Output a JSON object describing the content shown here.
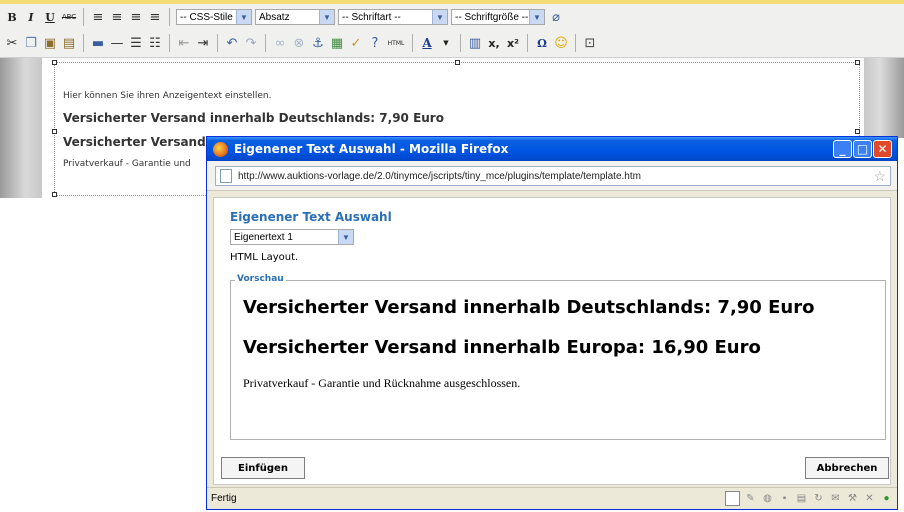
{
  "toolbar": {
    "row1": {
      "bold": "B",
      "italic": "I",
      "underline": "U",
      "strike": "ABC",
      "styles_select": "-- CSS-Stile --",
      "format_select": "Absatz",
      "font_select": "-- Schriftart --",
      "size_select": "-- Schriftgröße --"
    },
    "row2": {
      "html_button": "HTML",
      "subscript": "x,",
      "superscript": "x²",
      "omega": "Ω"
    }
  },
  "editor": {
    "hint": "Hier können Sie ihren Anzeigentext einstellen.",
    "line1": "Versicherter Versand innerhalb Deutschlands: 7,90 Euro",
    "line2": "Versicherter Versand in",
    "line3": "Privatverkauf - Garantie und"
  },
  "popup": {
    "title": "Eigenener Text Auswahl - Mozilla Firefox",
    "url": "http://www.auktions-vorlage.de/2.0/tinymce/jscripts/tiny_mce/plugins/template/template.htm",
    "dialog_title": "Eigenener Text Auswahl",
    "template_select": "Eigenertext 1",
    "layout_text": "HTML Layout.",
    "preview_legend": "Vorschau",
    "preview_heading1": "Versicherter Versand innerhalb Deutschlands: 7,90 Euro",
    "preview_heading2": "Versicherter Versand innerhalb Europa: 16,90 Euro",
    "preview_paragraph": "Privatverkauf - Garantie und Rücknahme ausgeschlossen.",
    "insert_button": "Einfügen",
    "cancel_button": "Abbrechen",
    "status": "Fertig"
  },
  "colors": {
    "titlebar": "#0054e3",
    "dialog_heading": "#2b6fb6",
    "top_accent": "#f3dc78"
  }
}
